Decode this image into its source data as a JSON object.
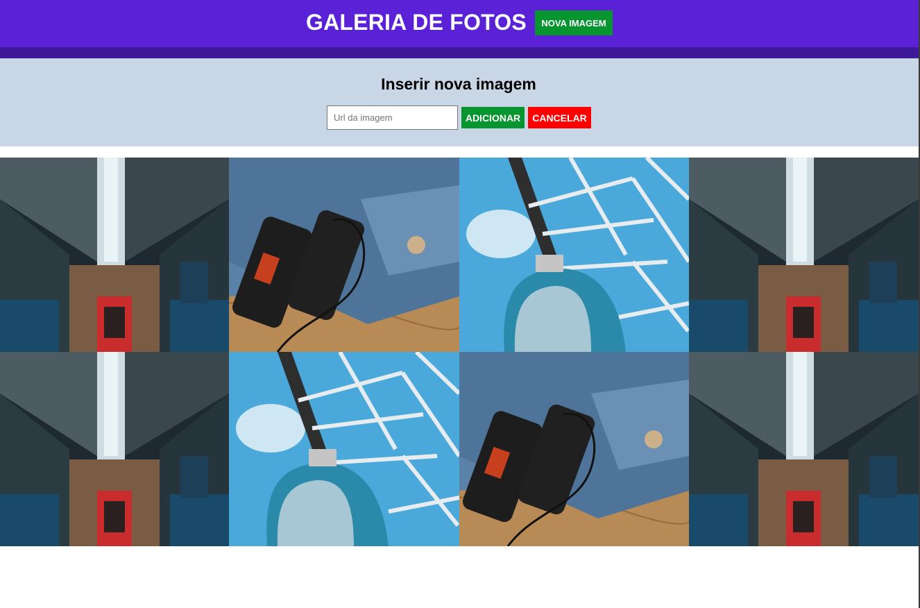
{
  "header": {
    "title": "GALERIA DE FOTOS",
    "new_image_label": "NOVA IMAGEM"
  },
  "insert_panel": {
    "title": "Inserir nova imagem",
    "url_placeholder": "Url da imagem",
    "url_value": "",
    "add_label": "ADICIONAR",
    "cancel_label": "CANCELAR"
  },
  "gallery": {
    "images": [
      {
        "subject": "train-interior"
      },
      {
        "subject": "binoculars-on-denim"
      },
      {
        "subject": "ferris-wheel-gondola"
      },
      {
        "subject": "train-interior"
      },
      {
        "subject": "train-interior"
      },
      {
        "subject": "ferris-wheel-gondola"
      },
      {
        "subject": "binoculars-on-denim"
      },
      {
        "subject": "train-interior"
      }
    ]
  },
  "colors": {
    "header_bg": "#5b21d6",
    "header_strip": "#3c1a98",
    "panel_bg": "#c8d6e5",
    "primary_green": "#07952f",
    "cancel_red": "#ff0000"
  }
}
